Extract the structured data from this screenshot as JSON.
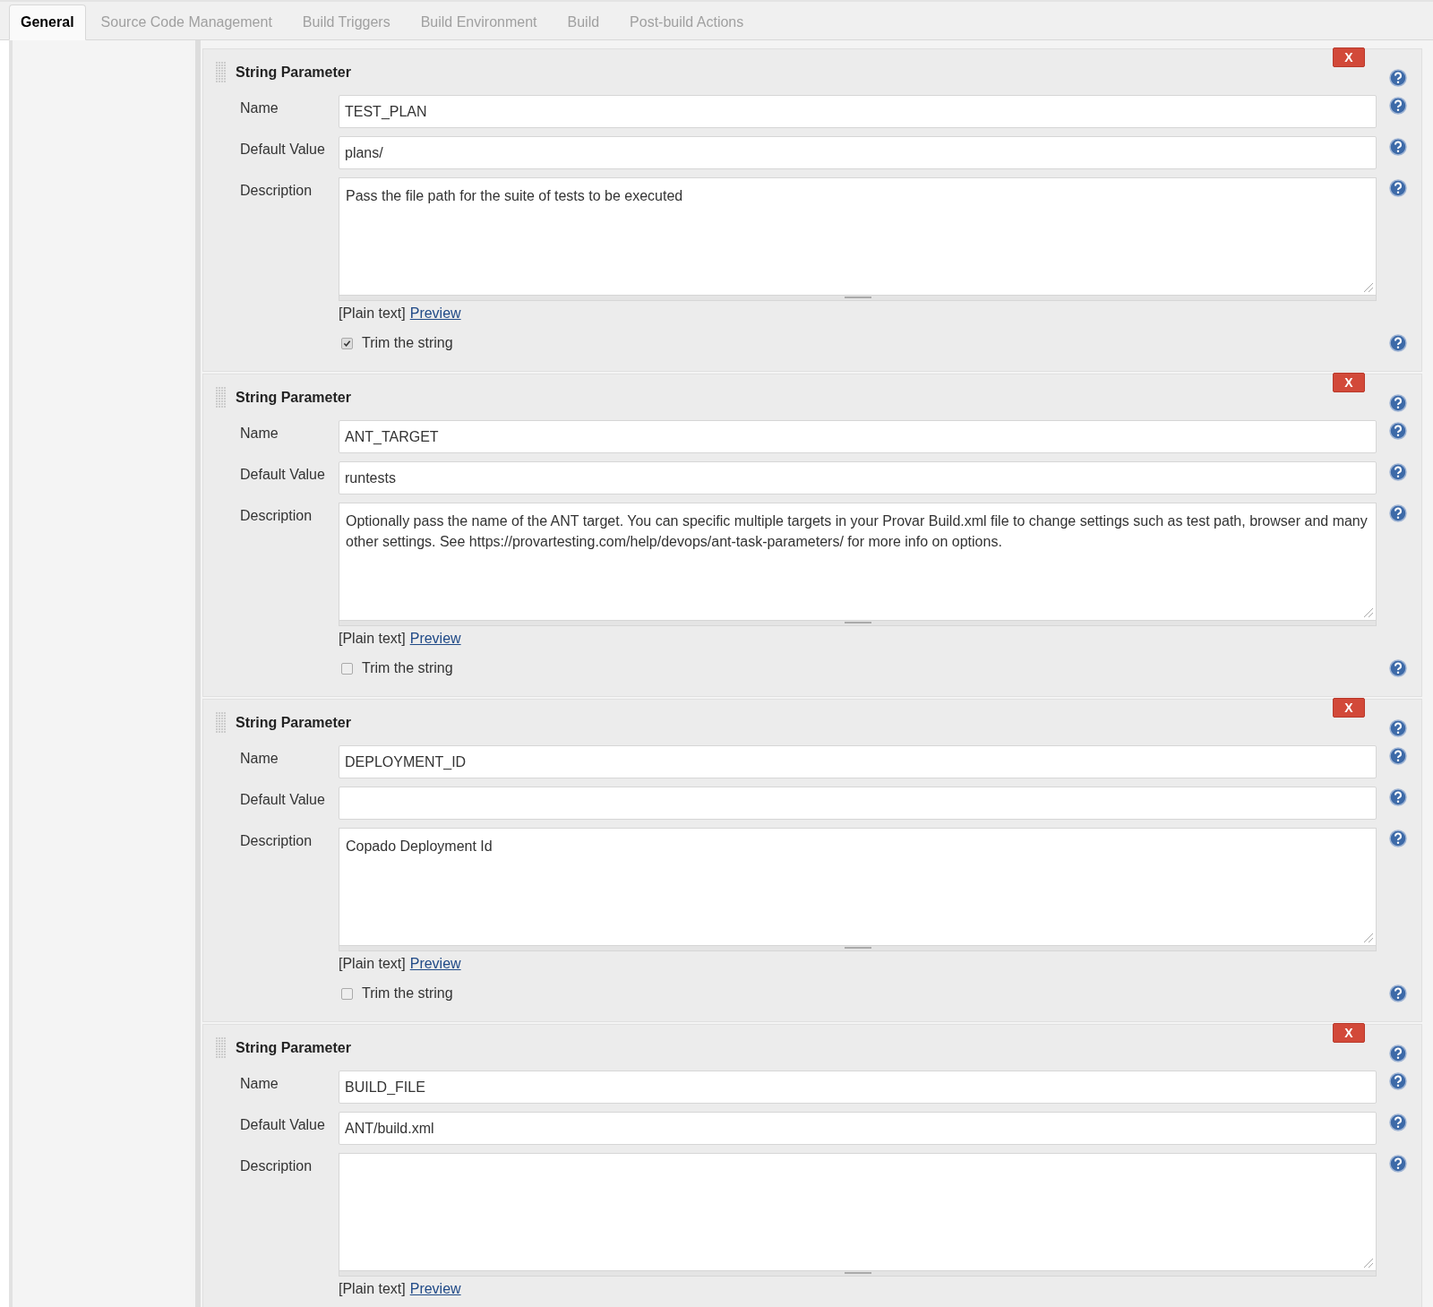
{
  "tabs": [
    {
      "label": "General",
      "selected": true
    },
    {
      "label": "Source Code Management",
      "selected": false
    },
    {
      "label": "Build Triggers",
      "selected": false
    },
    {
      "label": "Build Environment",
      "selected": false
    },
    {
      "label": "Build",
      "selected": false
    },
    {
      "label": "Post-build Actions",
      "selected": false
    }
  ],
  "parameters": [
    {
      "title": "String Parameter",
      "delete": "X",
      "fields": [
        {
          "kind": "input",
          "label": "Name",
          "value": "TEST_PLAN"
        },
        {
          "kind": "input",
          "label": "Default Value",
          "value": "plans/"
        },
        {
          "kind": "textarea",
          "label": "Description",
          "value": "Pass the file path for the suite of tests to be executed"
        }
      ],
      "format": "[Plain text]",
      "preview": "Preview",
      "trim": {
        "label": "Trim the string",
        "checked": true
      }
    },
    {
      "title": "String Parameter",
      "delete": "X",
      "fields": [
        {
          "kind": "input",
          "label": "Name",
          "value": "ANT_TARGET"
        },
        {
          "kind": "input",
          "label": "Default Value",
          "value": "runtests"
        },
        {
          "kind": "textarea",
          "label": "Description",
          "value": "Optionally pass the name of the ANT target. You can specific multiple targets in your Provar Build.xml file to change settings such as test path, browser and many other settings. See https://provartesting.com/help/devops/ant-task-parameters/ for more info on options."
        }
      ],
      "format": "[Plain text]",
      "preview": "Preview",
      "trim": {
        "label": "Trim the string",
        "checked": false
      }
    },
    {
      "title": "String Parameter",
      "delete": "X",
      "fields": [
        {
          "kind": "input",
          "label": "Name",
          "value": "DEPLOYMENT_ID"
        },
        {
          "kind": "input",
          "label": "Default Value"
        },
        {
          "kind": "textarea",
          "label": "Description",
          "value": "Copado Deployment Id"
        }
      ],
      "format": "[Plain text]",
      "preview": "Preview",
      "trim": {
        "label": "Trim the string",
        "checked": false
      }
    },
    {
      "title": "String Parameter",
      "delete": "X",
      "fields": [
        {
          "kind": "input",
          "label": "Name",
          "value": "BUILD_FILE"
        },
        {
          "kind": "input",
          "label": "Default Value",
          "value": "ANT/build.xml"
        },
        {
          "kind": "textarea",
          "label": "Description"
        }
      ],
      "format": "[Plain text]",
      "preview": "Preview"
    }
  ]
}
